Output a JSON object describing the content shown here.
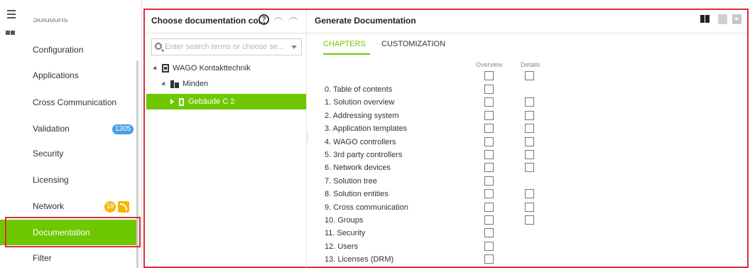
{
  "nav": {
    "partial_label": "Solutions",
    "items": [
      {
        "label": "Configuration"
      },
      {
        "label": "Applications"
      },
      {
        "label": "Cross Communication"
      },
      {
        "label": "Validation",
        "badge": "1305"
      },
      {
        "label": "Security"
      },
      {
        "label": "Licensing"
      },
      {
        "label": "Network",
        "badge": "18"
      },
      {
        "label": "Documentation",
        "active": true
      },
      {
        "label": "Filter"
      }
    ]
  },
  "left_panel": {
    "title": "Choose documentation co...",
    "search_placeholder": "Enter search terms or choose se...",
    "tree": [
      {
        "label": "WAGO Kontakttechnik",
        "level": 0
      },
      {
        "label": "Minden",
        "level": 1
      },
      {
        "label": "Gebäude C 2",
        "level": 2,
        "selected": true
      }
    ]
  },
  "right_panel": {
    "title": "Generate Documentation",
    "tabs": [
      {
        "label": "CHAPTERS",
        "active": true
      },
      {
        "label": "CUSTOMIZATION",
        "active": false
      }
    ],
    "columns": {
      "overview": "Overview",
      "details": "Details"
    },
    "chapters": [
      {
        "label": "0. Table of contents",
        "details": false
      },
      {
        "label": "1. Solution overview",
        "details": true
      },
      {
        "label": "2. Addressing system",
        "details": true
      },
      {
        "label": "3. Application templates",
        "details": true
      },
      {
        "label": "4. WAGO controllers",
        "details": true
      },
      {
        "label": "5. 3rd party controllers",
        "details": true
      },
      {
        "label": "6. Network devices",
        "details": true
      },
      {
        "label": "7. Solution tree",
        "details": false
      },
      {
        "label": "8. Solution entities",
        "details": true
      },
      {
        "label": "9. Cross communication",
        "details": true
      },
      {
        "label": "10. Groups",
        "details": true
      },
      {
        "label": "11. Security",
        "details": false
      },
      {
        "label": "12. Users",
        "details": false
      },
      {
        "label": "13. Licenses (DRM)",
        "details": false
      }
    ]
  },
  "colors": {
    "accent": "#6ec800",
    "highlight_frame": "#d9303a",
    "badge_blue": "#4a9ee8",
    "badge_orange": "#f5b800"
  },
  "icons": [
    "menu-icon",
    "help-icon",
    "undo-icon",
    "redo-icon",
    "search-icon",
    "book-icon",
    "pdf-icon",
    "download-icon",
    "rss-icon"
  ]
}
